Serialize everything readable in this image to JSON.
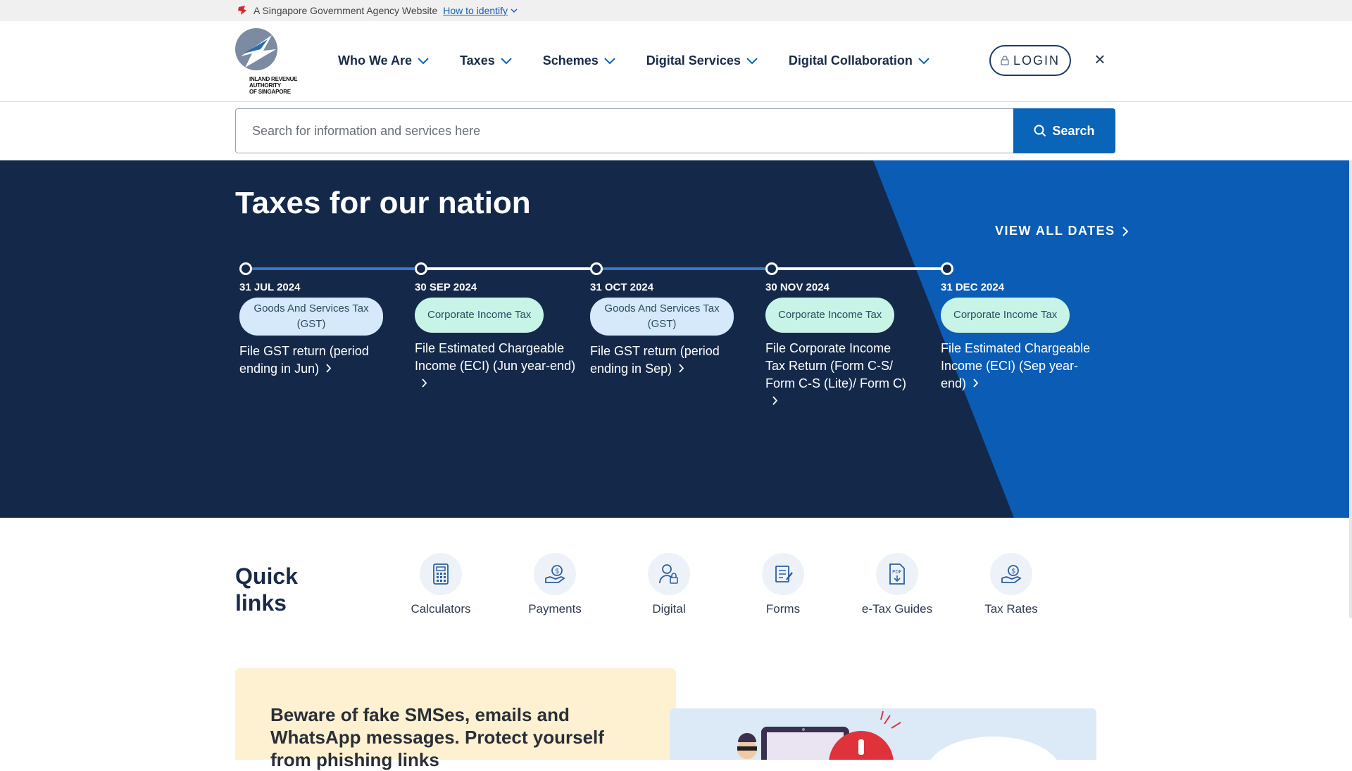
{
  "gov_banner": {
    "text": "A Singapore Government Agency Website",
    "link": "How to identify"
  },
  "header": {
    "logo_lines": [
      "INLAND REVENUE",
      "AUTHORITY",
      "OF SINGAPORE"
    ],
    "nav": [
      {
        "label": "Who We Are"
      },
      {
        "label": "Taxes"
      },
      {
        "label": "Schemes"
      },
      {
        "label": "Digital Services"
      },
      {
        "label": "Digital Collaboration"
      }
    ],
    "login_label": "LOGIN",
    "close_label": "×"
  },
  "search": {
    "placeholder": "Search for information and services here",
    "button_label": "Search"
  },
  "hero": {
    "title": "Taxes for our nation",
    "view_all": "VIEW ALL DATES",
    "deadlines": [
      {
        "date": "31 JUL 2024",
        "tag": "Goods And Services Tax (GST)",
        "desc": "File GST return (period ending in Jun)"
      },
      {
        "date": "30 SEP 2024",
        "tag": "Corporate Income Tax",
        "desc": "File Estimated Chargeable Income (ECI) (Jun year-end)"
      },
      {
        "date": "31 OCT 2024",
        "tag": "Goods And Services Tax (GST)",
        "desc": "File GST return (period ending in Sep)"
      },
      {
        "date": "30 NOV 2024",
        "tag": "Corporate Income Tax",
        "desc": "File Corporate Income Tax Return (Form C-S/ Form C-S (Lite)/ Form C)"
      },
      {
        "date": "31 DEC 2024",
        "tag": "Corporate Income Tax",
        "desc": "File Estimated Chargeable Income (ECI) (Sep year-end)"
      }
    ]
  },
  "quick_links": {
    "title_line1": "Quick",
    "title_line2": "links",
    "items": [
      {
        "label": "Calculators",
        "icon": "calculator-icon"
      },
      {
        "label": "Payments",
        "icon": "payment-icon"
      },
      {
        "label": "Digital",
        "icon": "digital-services-icon"
      },
      {
        "label": "Forms",
        "icon": "forms-icon"
      },
      {
        "label": "e-Tax Guides",
        "icon": "pdf-guide-icon"
      },
      {
        "label": "Tax Rates",
        "icon": "tax-rates-icon"
      }
    ]
  },
  "phishing": {
    "text": "Beware of fake SMSes, emails and WhatsApp messages. Protect yourself from phishing links"
  },
  "colors": {
    "navy": "#14294a",
    "blue": "#0a64b8",
    "gst_tag": "#d5e9fb",
    "cit_tag": "#c7f4e7"
  }
}
